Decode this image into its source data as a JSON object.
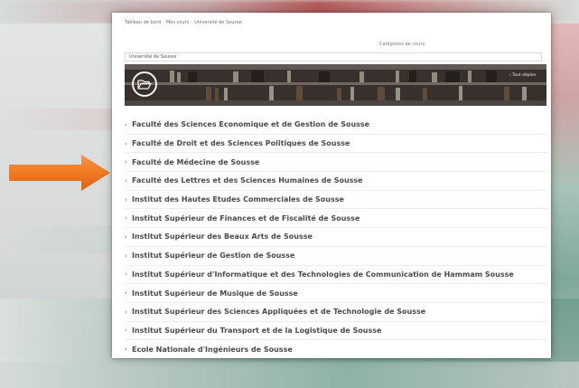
{
  "breadcrumb": [
    "Tableau de bord",
    "Mes cours",
    "Université de Sousse"
  ],
  "category_label": "Catégories de cours:",
  "category_select": "Université de Sousse",
  "expand_link": "Tout déplier",
  "list_items": [
    "Faculté des Sciences Economique et de Gestion de Sousse",
    "Faculté de Droit et des Sciences Politiques de Sousse",
    "Faculté de Médecine de Sousse",
    "Faculté des Lettres et des Sciences Humaines de Sousse",
    "Institut des Hautes Etudes Commerciales de Sousse",
    "Institut Supérieur de Finances et de Fiscalité de Sousse",
    "Institut Supérieur des Beaux Arts de Sousse",
    "Institut Supérieur de Gestion de Sousse",
    "Institut Supérieur d'Informatique et des Technologies de Communication de Hammam Sousse",
    "Institut Supérieur de Musique de Sousse",
    "Institut Supérieur des Sciences Appliquées et de Technologie de Sousse",
    "Institut Supérieur du Transport et de la Logistique de Sousse",
    "Ecole Nationale d'Ingénieurs de Sousse"
  ],
  "icons": {
    "banner": "folder-open-icon",
    "item": "chevron-right-icon",
    "pointer": "orange-arrow-icon"
  },
  "colors": {
    "arrow": "#f07a22",
    "text": "#4a4a4a",
    "divider": "#ececec"
  }
}
